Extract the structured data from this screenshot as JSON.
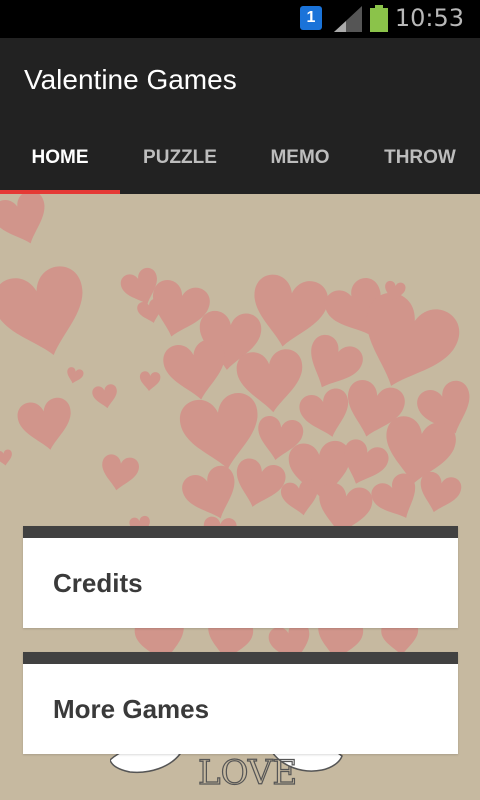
{
  "status_bar": {
    "time": "10:53",
    "sim_badge": "1"
  },
  "app": {
    "title": "Valentine Games"
  },
  "tabs": [
    {
      "label": "HOME",
      "active": true
    },
    {
      "label": "PUZZLE",
      "active": false
    },
    {
      "label": "MEMO",
      "active": false
    },
    {
      "label": "THROW",
      "active": false
    }
  ],
  "cards": [
    {
      "label": "Credits"
    },
    {
      "label": "More Games"
    }
  ],
  "background_art": {
    "text": "LOVE"
  },
  "colors": {
    "background": "#c6b9a0",
    "heart": "#d3918a",
    "appbar": "#222222",
    "tab_indicator": "#e53935",
    "card_header": "#414141"
  }
}
